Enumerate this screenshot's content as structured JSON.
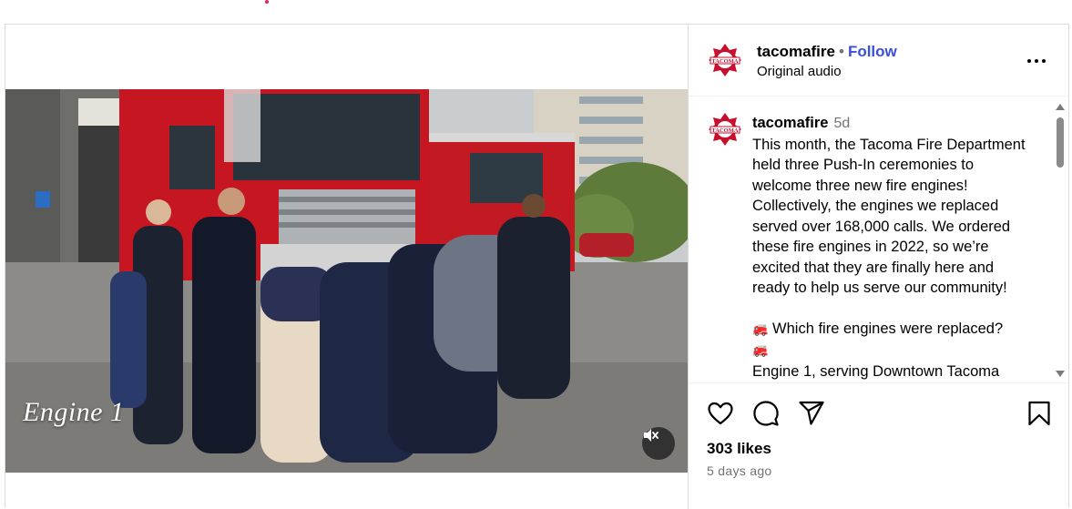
{
  "post": {
    "video_overlay_text": "Engine 1",
    "account": {
      "username": "tacomafire",
      "separator": "•",
      "follow_label": "Follow",
      "audio_label": "Original audio",
      "avatar_icon": "tacoma-fire-badge-icon"
    },
    "caption": {
      "username": "tacomafire",
      "time": "5d",
      "text": "This month, the Tacoma Fire Department held three Push-In ceremonies to welcome three new fire engines! Collectively, the engines we replaced served over 168,000 calls. We ordered these fire engines in 2022, so we’re excited that they are finally here and ready to help us serve our community!",
      "question_emoji": "🚒",
      "question": "Which fire engines were replaced?",
      "next_emoji": "🚒",
      "next_partial": "Engine 1, serving Downtown Tacoma"
    },
    "stats": {
      "likes": "303 likes",
      "posted": "5 days ago"
    }
  },
  "colors": {
    "follow_blue": "#3b4fd8",
    "muted_gray": "#737373",
    "badge_red": "#c8102e"
  },
  "icons": [
    "more-icon",
    "heart-icon",
    "comment-icon",
    "share-icon",
    "bookmark-icon",
    "mute-icon"
  ]
}
